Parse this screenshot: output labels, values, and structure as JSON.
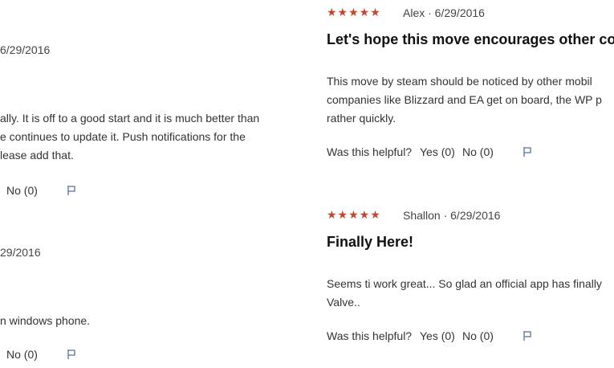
{
  "left_column": {
    "review1": {
      "date_fragment": "6/29/2016",
      "body_lines": [
        "ally. It is off to a good start and it is much better than",
        "e continues to update it. Push notifications for the",
        "lease add that."
      ],
      "no_label": "No (0)"
    },
    "review2": {
      "date_fragment": "29/2016",
      "body_lines": [
        "n windows phone."
      ],
      "no_label": "No (0)"
    }
  },
  "right_column": {
    "review1": {
      "stars": "★★★★★",
      "meta": "Alex · 6/29/2016",
      "title": "Let's hope this move encourages other co",
      "body_lines": [
        "This move by steam should be noticed by other mobil",
        "companies like Blizzard and EA get on board, the WP p",
        "rather quickly."
      ],
      "helpful_label": "Was this helpful?",
      "yes_label": "Yes (0)",
      "no_label": "No (0)"
    },
    "review2": {
      "stars": "★★★★★",
      "meta": "Shallon · 6/29/2016",
      "title": "Finally Here!",
      "body_lines": [
        "Seems ti work great... So glad an official app has finally",
        "Valve.."
      ],
      "helpful_label": "Was this helpful?",
      "yes_label": "Yes (0)",
      "no_label": "No (0)"
    }
  },
  "colors": {
    "star": "#c2462f",
    "flag": "#5b6f9c"
  },
  "icons": [
    "flag-icon"
  ]
}
